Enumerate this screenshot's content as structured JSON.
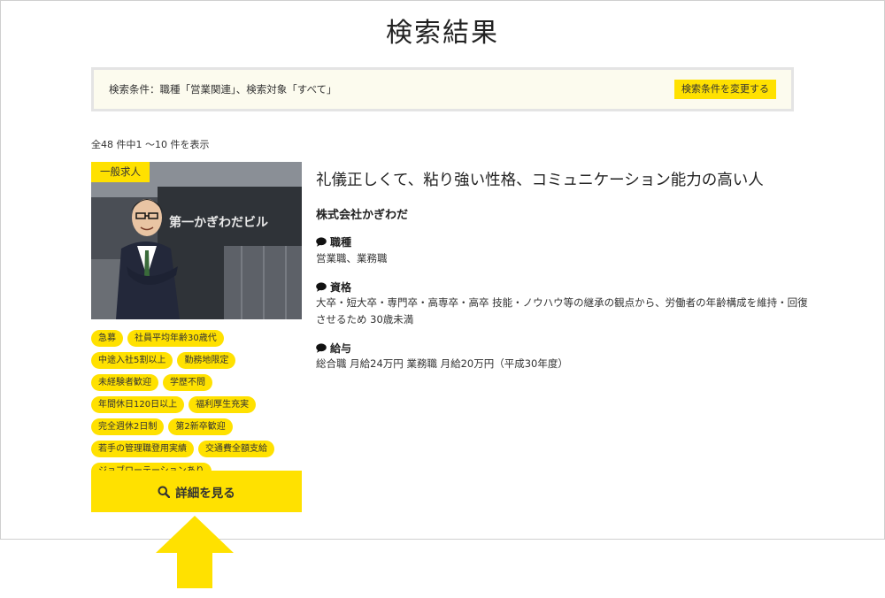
{
  "page": {
    "title": "検索結果"
  },
  "search": {
    "conditions": "検索条件：職種「営業関連」、検索対象「すべて」",
    "change_label": "検索条件を変更する"
  },
  "results": {
    "count_text": "全48 件中1 〜10 件を表示"
  },
  "job": {
    "type_badge": "一般求人",
    "photo_sign_text": "第一かぎわだビル",
    "title": "礼儀正しくて、粘り強い性格、コミュニケーション能力の高い人",
    "company": "株式会社かぎわだ",
    "tags": [
      "急募",
      "社員平均年齢30歳代",
      "中途入社5割以上",
      "勤務地限定",
      "未経験者歓迎",
      "学歴不問",
      "年間休日120日以上",
      "福利厚生充実",
      "完全週休2日制",
      "第2新卒歓迎",
      "若手の管理職登用実績",
      "交通費全額支給",
      "ジョブローテーションあり"
    ],
    "occupation_label": "職種",
    "occupation_text": "営業職、業務職",
    "qualification_label": "資格",
    "qualification_text": "大卒・短大卒・専門卒・高専卒・高卒 技能・ノウハウ等の継承の観点から、労働者の年齢構成を維持・回復させるため 30歳未満",
    "salary_label": "給与",
    "salary_text": "総合職 月給24万円 業務職 月給20万円（平成30年度）",
    "detail_button_label": "詳細を見る"
  },
  "colors": {
    "accent": "#ffe100",
    "search_bg": "#fcfbee",
    "search_border": "#e4e4e4"
  },
  "icons": {
    "section_icon": "speech-bubble-icon",
    "detail_icon": "search-icon",
    "pointer": "up-arrow-icon"
  }
}
